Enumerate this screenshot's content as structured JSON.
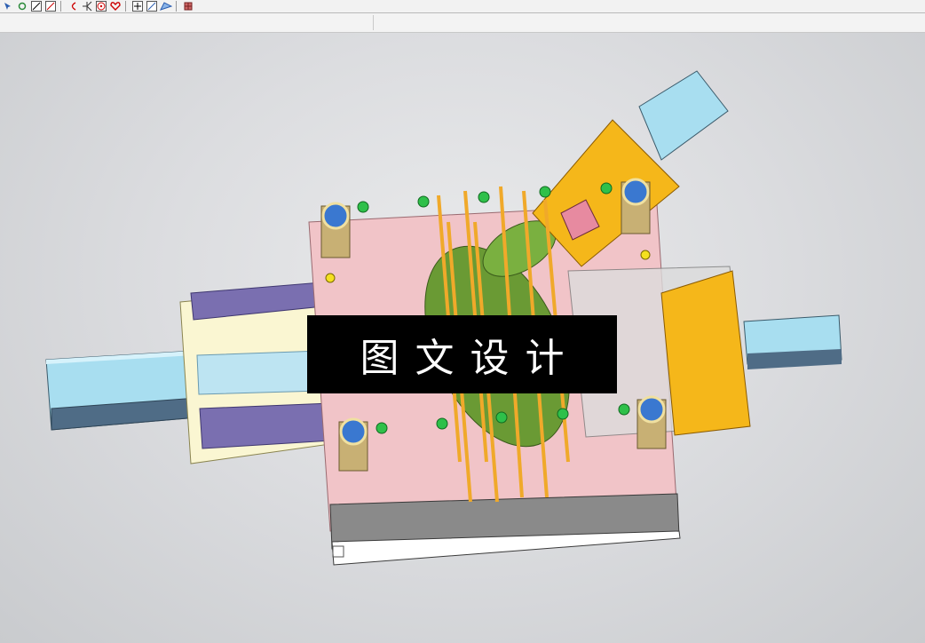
{
  "toolbar": {
    "icons": [
      "select-icon",
      "rotate-icon",
      "line-icon",
      "pen-icon",
      "arc-icon",
      "point-icon",
      "circle-target-icon",
      "heart-shape-icon",
      "plus-icon",
      "edit-icon",
      "view-icon",
      "grid-icon"
    ]
  },
  "watermark": {
    "text": "图文设计"
  },
  "colors": {
    "background": "#d4d6d8",
    "mold_plate": "#f1c4c8",
    "slider_yellow": "#f5b71a",
    "slider_purple": "#7a6fb0",
    "cylinder_blue": "#a8def0",
    "ejector_orange": "#f0a92a",
    "part_green": "#6a9a34",
    "guide_pin": "#3a78d0",
    "base_gray": "#8a8a8a"
  }
}
